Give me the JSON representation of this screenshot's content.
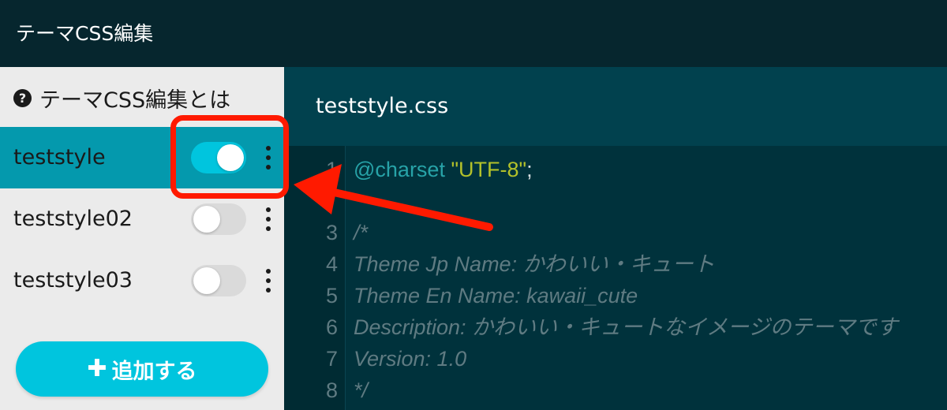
{
  "header": {
    "title": "テーマCSS編集"
  },
  "sidebar": {
    "help_label": "テーマCSS編集とは",
    "styles": [
      {
        "name": "teststyle",
        "enabled": true,
        "active": true
      },
      {
        "name": "teststyle02",
        "enabled": false,
        "active": false
      },
      {
        "name": "teststyle03",
        "enabled": false,
        "active": false
      }
    ],
    "add_button": {
      "icon": "plus-icon",
      "label": "追加する"
    }
  },
  "editor": {
    "filename": "teststyle.css",
    "lines": [
      {
        "num": "1",
        "tokens": [
          {
            "t": "@charset",
            "c": "kw"
          },
          {
            "t": " ",
            "c": "punct"
          },
          {
            "t": "\"UTF-8\"",
            "c": "str"
          },
          {
            "t": ";",
            "c": "punct"
          }
        ]
      },
      {
        "num": "",
        "tokens": []
      },
      {
        "num": "3",
        "tokens": [
          {
            "t": "/*",
            "c": "comment"
          }
        ]
      },
      {
        "num": "4",
        "tokens": [
          {
            "t": "Theme Jp Name: かわいい・キュート",
            "c": "comment"
          }
        ]
      },
      {
        "num": "5",
        "tokens": [
          {
            "t": "Theme En Name: kawaii_cute",
            "c": "comment"
          }
        ]
      },
      {
        "num": "6",
        "tokens": [
          {
            "t": "Description: かわいい・キュートなイメージのテーマです",
            "c": "comment"
          }
        ]
      },
      {
        "num": "7",
        "tokens": [
          {
            "t": "Version: 1.0",
            "c": "comment"
          }
        ]
      },
      {
        "num": "8",
        "tokens": [
          {
            "t": "*/",
            "c": "comment"
          }
        ]
      }
    ]
  },
  "colors": {
    "accent": "#00c5de",
    "active_row": "#0499ad",
    "annotation": "#ff1a00"
  }
}
